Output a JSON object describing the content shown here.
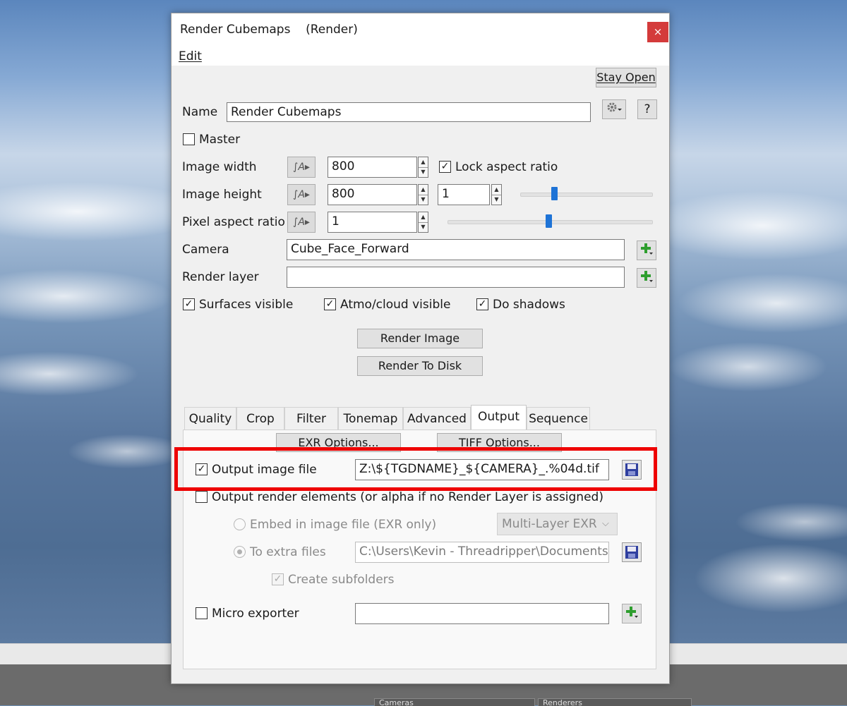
{
  "window": {
    "title": "Render Cubemaps",
    "title_suffix": "(Render)",
    "close_symbol": "×"
  },
  "menu": {
    "edit": "Edit"
  },
  "toolbar": {
    "stay_open": "Stay Open"
  },
  "name_row": {
    "label": "Name",
    "value": "Render Cubemaps",
    "gear_icon": "gear-dropdown-icon",
    "help": "?"
  },
  "master": {
    "label": "Master",
    "checked": false
  },
  "image_width": {
    "label": "Image width",
    "value": "800"
  },
  "lock_aspect": {
    "label": "Lock aspect ratio",
    "checked": true
  },
  "image_height": {
    "label": "Image height",
    "value": "800",
    "secondary_value": "1"
  },
  "pixel_aspect": {
    "label": "Pixel aspect ratio",
    "value": "1"
  },
  "camera": {
    "label": "Camera",
    "value": "Cube_Face_Forward"
  },
  "render_layer": {
    "label": "Render layer",
    "value": ""
  },
  "visibility": {
    "surfaces": {
      "label": "Surfaces visible",
      "checked": true
    },
    "atmo": {
      "label": "Atmo/cloud visible",
      "checked": true
    },
    "shadows": {
      "label": "Do shadows",
      "checked": true
    }
  },
  "actions": {
    "render_image": "Render Image",
    "render_to_disk": "Render To Disk"
  },
  "tabs": [
    {
      "label": "Quality"
    },
    {
      "label": "Crop"
    },
    {
      "label": "Filter"
    },
    {
      "label": "Tonemap"
    },
    {
      "label": "Advanced"
    },
    {
      "label": "Output",
      "active": true
    },
    {
      "label": "Sequence"
    }
  ],
  "output": {
    "exr_options": "EXR Options...",
    "tiff_options": "TIFF Options...",
    "output_image_file": {
      "label": "Output image file",
      "checked": true,
      "value": "Z:\\${TGDNAME}_${CAMERA}_.%04d.tif"
    },
    "render_elements": {
      "label": "Output render elements (or alpha if no Render Layer is assigned)",
      "checked": false
    },
    "embed": {
      "label": "Embed in image file (EXR only)",
      "selected": false
    },
    "embed_format": "Multi-Layer EXR",
    "extra_files": {
      "label": "To extra files",
      "selected": true,
      "value": "C:\\Users\\Kevin - Threadripper\\Documents\\$"
    },
    "create_subfolders": {
      "label": "Create subfolders",
      "checked": true
    },
    "micro_exporter": {
      "label": "Micro exporter",
      "checked": false,
      "value": ""
    }
  },
  "taskbar": {
    "panel_cameras": "Cameras",
    "panel_renderers": "Renderers"
  },
  "colors": {
    "highlight": "#ee0000",
    "close_button": "#d43b3b",
    "slider_thumb": "#1e73d6",
    "add_icon": "#2e9e2e",
    "save_icon": "#2f3f9f"
  }
}
